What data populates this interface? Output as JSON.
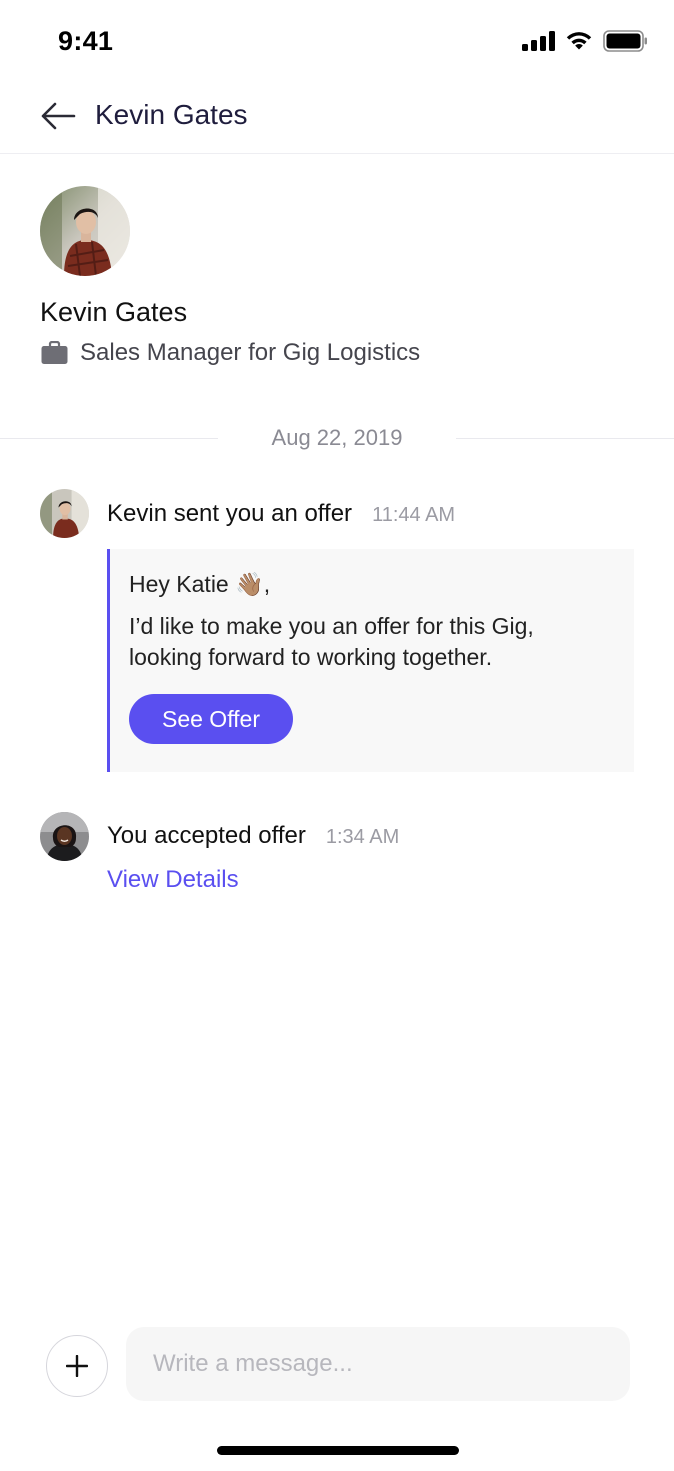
{
  "status_bar": {
    "time": "9:41",
    "icons": [
      "cellular-signal-icon",
      "wifi-icon",
      "battery-icon"
    ]
  },
  "header": {
    "back_icon": "arrow-left-icon",
    "title": "Kevin Gates"
  },
  "profile": {
    "name": "Kevin Gates",
    "role_icon": "briefcase-icon",
    "role": "Sales Manager for Gig Logistics"
  },
  "conversation": {
    "date": "Aug 22, 2019",
    "messages": [
      {
        "title": "Kevin sent you an offer",
        "time": "11:44 AM",
        "card": {
          "greeting": "Hey Katie",
          "greeting_emoji": "👋🏽",
          "greeting_suffix": ",",
          "body": "I’d like to make you an offer for this Gig, looking forward to working together.",
          "button_label": "See Offer"
        }
      },
      {
        "title": "You accepted offer",
        "time": "1:34 AM",
        "link_label": "View Details"
      }
    ]
  },
  "composer": {
    "add_icon": "plus-icon",
    "placeholder": "Write a message..."
  },
  "colors": {
    "accent": "#5a4ff0",
    "title_text": "#1f1d3d",
    "card_background": "#f8f8f8"
  }
}
